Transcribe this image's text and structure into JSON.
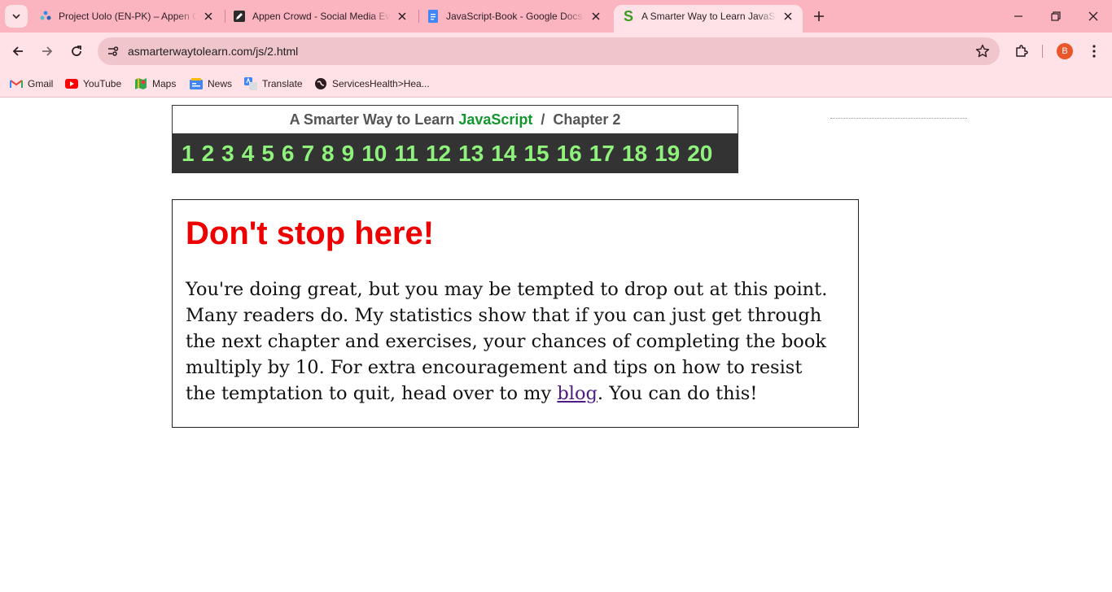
{
  "browser": {
    "tabs": [
      {
        "title": "Project Uolo (EN-PK) – Appen C",
        "icon": "appen-icon",
        "active": false
      },
      {
        "title": "Appen Crowd - Social Media Ev",
        "icon": "edit-icon",
        "active": false
      },
      {
        "title": "JavaScript-Book - Google Docs",
        "icon": "google-docs-icon",
        "active": false
      },
      {
        "title": "A Smarter Way to Learn JavaSc",
        "icon": "smarter-way-icon",
        "active": true
      }
    ],
    "url": "asmarterwaytolearn.com/js/2.html",
    "avatar_letter": "B",
    "bookmarks": [
      {
        "label": "Gmail",
        "icon": "gmail-icon"
      },
      {
        "label": "YouTube",
        "icon": "youtube-icon"
      },
      {
        "label": "Maps",
        "icon": "maps-icon"
      },
      {
        "label": "News",
        "icon": "news-icon"
      },
      {
        "label": "Translate",
        "icon": "translate-icon"
      },
      {
        "label": "ServicesHealth>Hea...",
        "icon": "globe-icon"
      }
    ]
  },
  "page": {
    "header": {
      "title_prefix": "A Smarter Way to Learn",
      "title_highlight": "JavaScript",
      "separator": "/",
      "chapter": "Chapter 2"
    },
    "chapters": [
      "1",
      "2",
      "3",
      "4",
      "5",
      "6",
      "7",
      "8",
      "9",
      "10",
      "11",
      "12",
      "13",
      "14",
      "15",
      "16",
      "17",
      "18",
      "19",
      "20"
    ],
    "notice": {
      "heading": "Don't stop here!",
      "body_before_link": "You're doing great, but you may be tempted to drop out at this point. Many readers do. My statistics show that if you can just get through the next chapter and exercises, your chances of completing the book multiply by 10. For extra encouragement and tips on how to resist the temptation to quit, head over to my ",
      "link_text": "blog",
      "body_after_link": ". You can do this!"
    }
  },
  "colors": {
    "tab_strip": "#fbb5c1",
    "toolbar": "#ffe2e7",
    "chapter_bar": "#333333",
    "chapter_numbers": "#8ff27c",
    "javascript_green": "#12962e",
    "heading_red": "#ee0000",
    "link": "#4b1e86"
  }
}
